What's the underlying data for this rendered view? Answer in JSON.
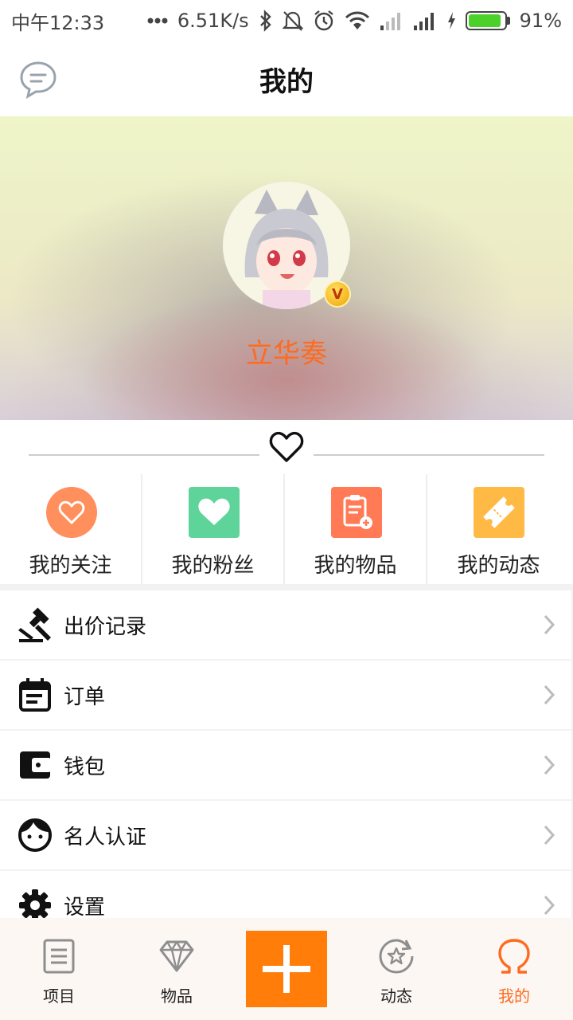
{
  "status_bar": {
    "time": "中午12:33",
    "net_speed": "6.51K/s",
    "battery_percent_text": "91%",
    "battery_level": 0.91,
    "icons": [
      "dots-icon",
      "bluetooth-icon",
      "mute-icon",
      "alarm-icon",
      "wifi-icon",
      "signal-icon",
      "signal-icon",
      "charging-icon",
      "battery-icon"
    ]
  },
  "header": {
    "title": "我的",
    "left_icon": "message-icon"
  },
  "profile": {
    "username": "立华奏",
    "badge_text": "V",
    "username_color": "#ff6a1e"
  },
  "quick_entries": [
    {
      "label": "我的关注",
      "icon": "heart-outline-icon",
      "color": "#ff8f5c"
    },
    {
      "label": "我的粉丝",
      "icon": "heart-filled-icon",
      "color": "#5ed49b"
    },
    {
      "label": "我的物品",
      "icon": "clipboard-add-icon",
      "color": "#ff7a55"
    },
    {
      "label": "我的动态",
      "icon": "ticket-icon",
      "color": "#ffba45"
    }
  ],
  "menu": [
    {
      "label": "出价记录",
      "icon": "gavel-icon"
    },
    {
      "label": "订单",
      "icon": "calendar-icon"
    },
    {
      "label": "钱包",
      "icon": "wallet-icon"
    },
    {
      "label": "名人认证",
      "icon": "face-icon"
    },
    {
      "label": "设置",
      "icon": "gear-icon"
    }
  ],
  "bottom_nav": {
    "items": [
      {
        "label": "项目",
        "icon": "list-icon"
      },
      {
        "label": "物品",
        "icon": "diamond-icon"
      },
      {
        "label": "动态",
        "icon": "star-refresh-icon"
      },
      {
        "label": "我的",
        "icon": "omega-icon"
      }
    ],
    "active_index": 3,
    "active_color": "#ff6a1e",
    "add_button_color": "#ff7d08"
  }
}
